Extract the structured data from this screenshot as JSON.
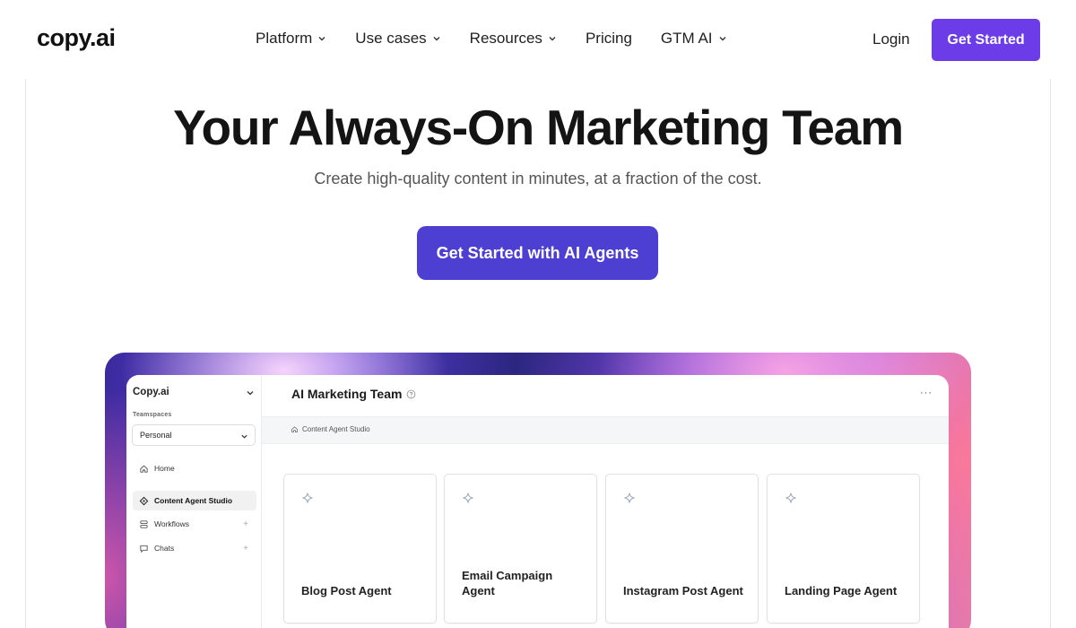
{
  "header": {
    "logo": "copy.ai",
    "nav": [
      {
        "label": "Platform",
        "has_dropdown": true
      },
      {
        "label": "Use cases",
        "has_dropdown": true
      },
      {
        "label": "Resources",
        "has_dropdown": true
      },
      {
        "label": "Pricing",
        "has_dropdown": false
      },
      {
        "label": "GTM AI",
        "has_dropdown": true
      }
    ],
    "login_label": "Login",
    "cta_label": "Get Started",
    "cta_color": "#6b3ce8"
  },
  "hero": {
    "title": "Your Always-On Marketing Team",
    "subtitle": "Create high-quality content in minutes, at a fraction of the cost.",
    "cta_label": "Get Started with AI Agents",
    "cta_color": "#4d3fd1"
  },
  "app": {
    "sidebar": {
      "brand": "Copy.ai",
      "teamspaces_label": "Teamspaces",
      "teamspace_value": "Personal",
      "items": [
        {
          "label": "Home",
          "icon": "home-icon",
          "active": false,
          "has_add": false
        },
        {
          "label": "Content Agent Studio",
          "icon": "agent-studio-icon",
          "active": true,
          "has_add": false
        },
        {
          "label": "Workflows",
          "icon": "workflows-icon",
          "active": false,
          "has_add": true
        },
        {
          "label": "Chats",
          "icon": "chats-icon",
          "active": false,
          "has_add": true
        }
      ],
      "add_symbol": "+"
    },
    "main": {
      "title": "AI Marketing Team",
      "more_symbol": "···",
      "breadcrumb": "Content Agent Studio",
      "cards": [
        {
          "label": "Blog Post Agent"
        },
        {
          "label": "Email Campaign Agent"
        },
        {
          "label": "Instagram Post Agent"
        },
        {
          "label": "Landing Page Agent"
        }
      ]
    }
  }
}
